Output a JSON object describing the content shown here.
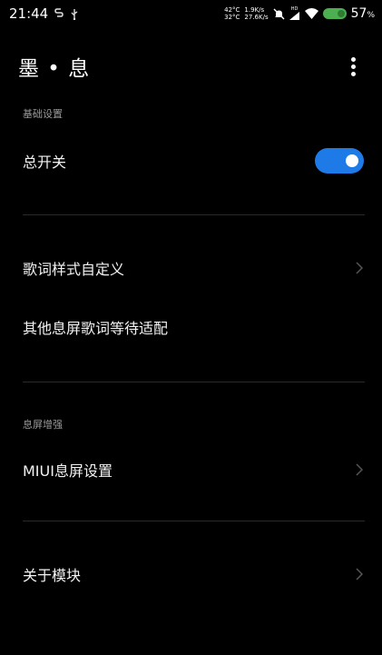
{
  "status_bar": {
    "time": "21:44",
    "temp_top": "42°C",
    "temp_bottom": "32°C",
    "speed_top": "1.9K/s",
    "speed_bottom": "27.6K/s",
    "hd_label": "HD",
    "battery_text": "57",
    "battery_unit": "%"
  },
  "header": {
    "title": "墨 • 息"
  },
  "sections": {
    "basic": {
      "title": "基础设置",
      "master_switch_label": "总开关",
      "master_switch_on": true
    },
    "lyrics": {
      "custom_style_label": "歌词样式自定义",
      "other_label": "其他息屏歌词等待适配"
    },
    "aod": {
      "title": "息屏增强",
      "miui_label": "MIUI息屏设置"
    },
    "about": {
      "about_label": "关于模块"
    }
  },
  "colors": {
    "background": "#000000",
    "accent": "#1e7ae6",
    "section_header": "#9a9a9a",
    "divider": "#2a2a2a"
  }
}
